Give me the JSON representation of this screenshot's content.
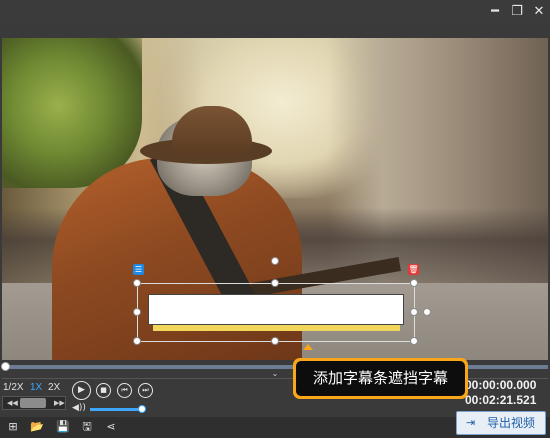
{
  "window": {
    "controls": [
      {
        "name": "minimize-icon",
        "glyph": "━"
      },
      {
        "name": "restore-icon",
        "glyph": "❐"
      },
      {
        "name": "close-icon",
        "glyph": "✕"
      }
    ]
  },
  "overlay": {
    "settings_badge_icon": "☰",
    "delete_badge_icon": "🗑"
  },
  "playback": {
    "speeds": [
      "1/2X",
      "1X",
      "2X"
    ],
    "active_speed": "1X",
    "current_time": "00:00:00.000",
    "total_time": "00:02:21.521",
    "progress_fraction": 0.005,
    "volume_fraction": 1.0,
    "collapse_glyph": "⌄",
    "buttons": {
      "play": "▶",
      "stop": "■",
      "prev": "⏮",
      "next": "⏭"
    }
  },
  "tooltip": {
    "text": "添加字幕条遮挡字幕"
  },
  "toolbar": {
    "icons": [
      {
        "name": "add-media-icon",
        "glyph": "⊞"
      },
      {
        "name": "open-folder-icon",
        "glyph": "📂"
      },
      {
        "name": "save-icon",
        "glyph": "💾"
      },
      {
        "name": "save-as-icon",
        "glyph": "🖫"
      },
      {
        "name": "share-icon",
        "glyph": "⋖"
      }
    ],
    "export_label": "导出视频",
    "export_icon": "⇥"
  },
  "colors": {
    "accent": "#3ea7ff",
    "tooltip_border": "#faa61a",
    "subtitle_bar": "#f0d75c",
    "delete_badge": "#e53935",
    "settings_badge": "#1e88e5"
  }
}
